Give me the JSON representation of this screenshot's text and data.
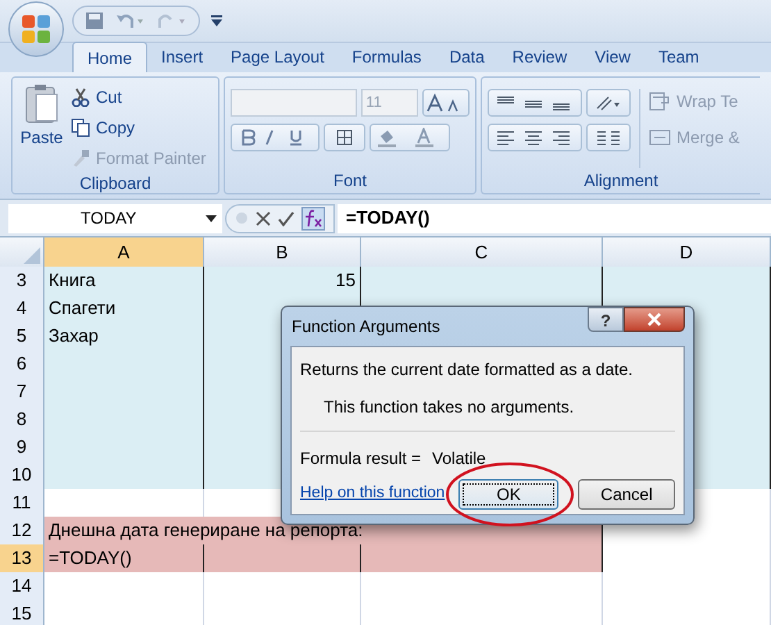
{
  "tabs": [
    {
      "label": "Home",
      "selected": true
    },
    {
      "label": "Insert",
      "selected": false
    },
    {
      "label": "Page Layout",
      "selected": false
    },
    {
      "label": "Formulas",
      "selected": false
    },
    {
      "label": "Data",
      "selected": false
    },
    {
      "label": "Review",
      "selected": false
    },
    {
      "label": "View",
      "selected": false
    },
    {
      "label": "Team",
      "selected": false
    }
  ],
  "clipboard": {
    "title": "Clipboard",
    "paste": "Paste",
    "cut": "Cut",
    "copy": "Copy",
    "format_painter": {
      "label": "Format Painter",
      "disabled": true
    }
  },
  "font": {
    "title": "Font",
    "size": {
      "value": "11",
      "disabled": true
    }
  },
  "alignment": {
    "title": "Alignment",
    "wrap": "Wrap Te",
    "merge": "Merge &"
  },
  "name_box": "TODAY",
  "formula": "=TODAY()",
  "columns": [
    {
      "label": "A",
      "selected": true
    },
    {
      "label": "B",
      "selected": false
    },
    {
      "label": "C",
      "selected": false
    },
    {
      "label": "D",
      "selected": false
    }
  ],
  "rows": [
    {
      "number": "3",
      "selected": false,
      "color": "#dbeef4",
      "cells": [
        "Книга",
        "15",
        "",
        ""
      ]
    },
    {
      "number": "4",
      "selected": false,
      "color": "#dbeef4",
      "cells": [
        "Спагети",
        "",
        "",
        ""
      ]
    },
    {
      "number": "5",
      "selected": false,
      "color": "#dbeef4",
      "cells": [
        "Захар",
        "",
        "",
        ""
      ]
    },
    {
      "number": "6",
      "selected": false,
      "color": "#dbeef4",
      "cells": [
        "",
        "",
        "",
        ""
      ]
    },
    {
      "number": "7",
      "selected": false,
      "color": "#dbeef4",
      "cells": [
        "",
        "",
        "",
        ""
      ]
    },
    {
      "number": "8",
      "selected": false,
      "color": "#dbeef4",
      "cells": [
        "",
        "",
        "",
        ""
      ]
    },
    {
      "number": "9",
      "selected": false,
      "color": "#dbeef4",
      "cells": [
        "",
        "",
        "",
        ""
      ]
    },
    {
      "number": "10",
      "selected": false,
      "color": "#dbeef4",
      "cells": [
        "",
        "",
        "",
        ""
      ]
    },
    {
      "number": "11",
      "selected": false,
      "cells": [
        "",
        "",
        "",
        ""
      ]
    },
    {
      "number": "12",
      "selected": false,
      "color": "#e6b9b8",
      "span": true,
      "cells": [
        "Днешна дата генериране на репорта:"
      ]
    },
    {
      "number": "13",
      "selected": true,
      "color": "#e6b9b8",
      "cells": [
        "=TODAY()",
        "",
        ""
      ]
    },
    {
      "number": "14",
      "selected": false,
      "cells": [
        "",
        "",
        "",
        ""
      ]
    },
    {
      "number": "15",
      "selected": false,
      "cells": [
        "",
        "",
        "",
        ""
      ]
    }
  ],
  "dialog": {
    "title": "Function Arguments",
    "help_button": "?",
    "description": "Returns the current date formatted as a date.",
    "note": "This function takes no arguments.",
    "result_label": "Formula result =",
    "result_value": "Volatile",
    "help_link": "Help on this function",
    "ok": "OK",
    "cancel": "Cancel",
    "ok_circled": true
  }
}
